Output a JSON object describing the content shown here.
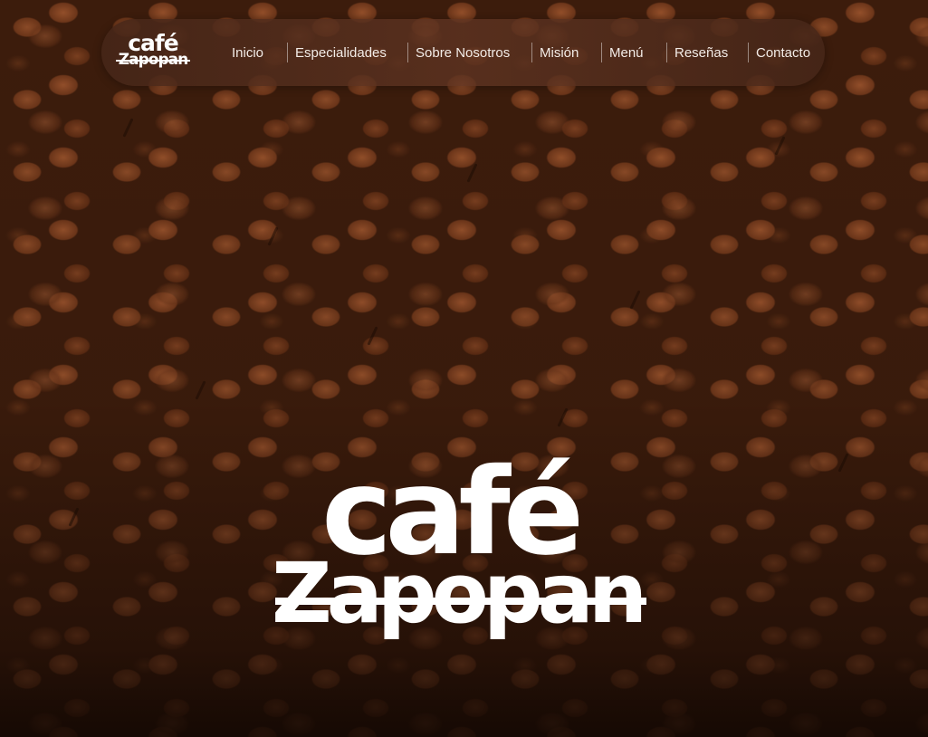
{
  "brand": {
    "logo_line1": "café",
    "logo_line2": "Zapopan"
  },
  "nav": {
    "items": [
      {
        "label": "Inicio"
      },
      {
        "label": "Especialidades"
      },
      {
        "label": "Sobre Nosotros"
      },
      {
        "label": "Misión"
      },
      {
        "label": "Menú"
      },
      {
        "label": "Reseñas"
      },
      {
        "label": "Contacto"
      }
    ]
  },
  "hero": {
    "logo_line1": "café",
    "logo_line2": "Zapopan",
    "background": "coffee-beans-image"
  },
  "colors": {
    "navbar": "#5a3020",
    "text": "#ffffff",
    "background": "#3c1c0c"
  }
}
